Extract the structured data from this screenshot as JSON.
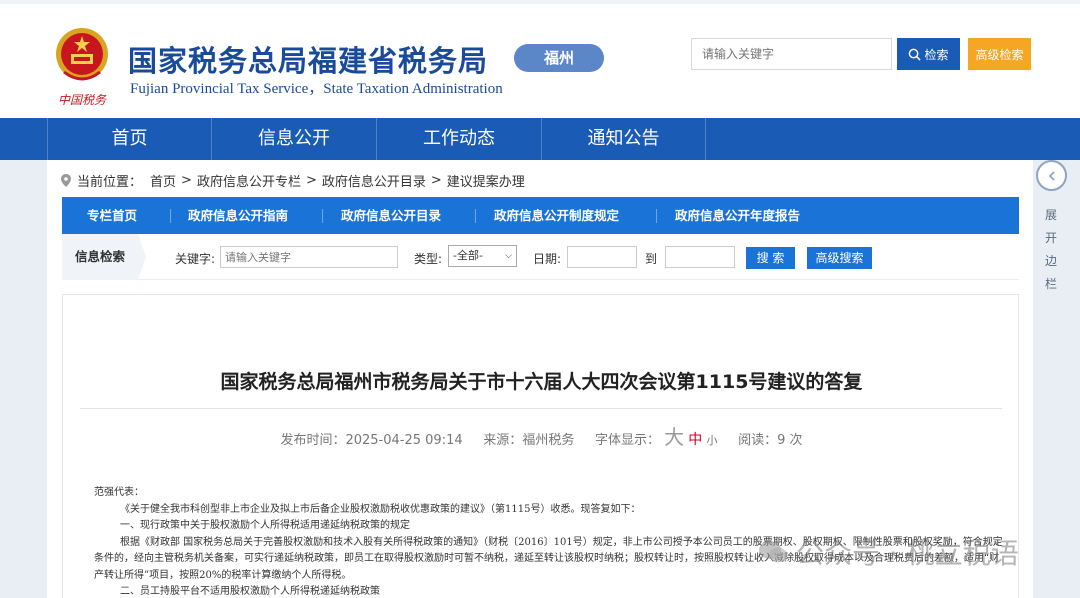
{
  "header": {
    "title": "国家税务总局福建省税务局",
    "subtitle": "Fujian Provincial Tax Service，State Taxation Administration",
    "city": "福州",
    "logo_text": "中国税务",
    "search_placeholder": "请输入关键字",
    "search_label": "检索",
    "advanced_label": "高级检索"
  },
  "mainnav": [
    "首页",
    "信息公开",
    "工作动态",
    "通知公告"
  ],
  "sidebar": {
    "toggle_label": "展开边栏"
  },
  "breadcrumb": {
    "prefix": "当前位置：",
    "items": [
      "首页",
      "政府信息公开专栏",
      "政府信息公开目录",
      "建议提案办理"
    ],
    "sep": ">"
  },
  "subnav": [
    "专栏首页",
    "政府信息公开指南",
    "政府信息公开目录",
    "政府信息公开制度规定",
    "政府信息公开年度报告"
  ],
  "filter": {
    "title": "信息检索",
    "keyword_label": "关键字:",
    "keyword_placeholder": "请输入关键字",
    "type_label": "类型:",
    "type_value": "-全部-",
    "date_label": "日期:",
    "to_label": "到",
    "search_btn": "搜 索",
    "adv_btn": "高级搜索"
  },
  "article": {
    "title": "国家税务总局福州市税务局关于市十六届人大四次会议第1115号建议的答复",
    "meta": {
      "publish_label": "发布时间：",
      "publish_time": "2025-04-25 09:14",
      "source_label": "来源：",
      "source": "福州税务",
      "font_label": "字体显示：",
      "size_large": "大",
      "size_medium": "中",
      "size_small": "小",
      "read_label": "阅读：",
      "read_count": "9 次"
    },
    "body": [
      "范强代表：",
      "《关于健全我市科创型非上市企业及拟上市后备企业股权激励税收优惠政策的建议》（第1115号）收悉。现答复如下：",
      "一、现行政策中关于股权激励个人所得税适用递延纳税政策的规定",
      "根据《财政部  国家税务总局关于完善股权激励和技术入股有关所得税政策的通知》（财税〔2016〕101号）规定，非上市公司授予本公司员工的股票期权、股权期权、限制性股票和股权奖励，符合规定条件的，经向主管税务机关备案，可实行递延纳税政策，即员工在取得股权激励时可暂不纳税，递延至转让该股权时纳税；股权转让时，按照股权转让收入减除股权取得成本以及合理税费后的差额，适用“财产转让所得”项目，按照20%的税率计算缴纳个人所得税。",
      "二、员工持股平台不适用股权激励个人所得税递延纳税政策"
    ]
  },
  "watermark": "公众号 · 桃立税语"
}
